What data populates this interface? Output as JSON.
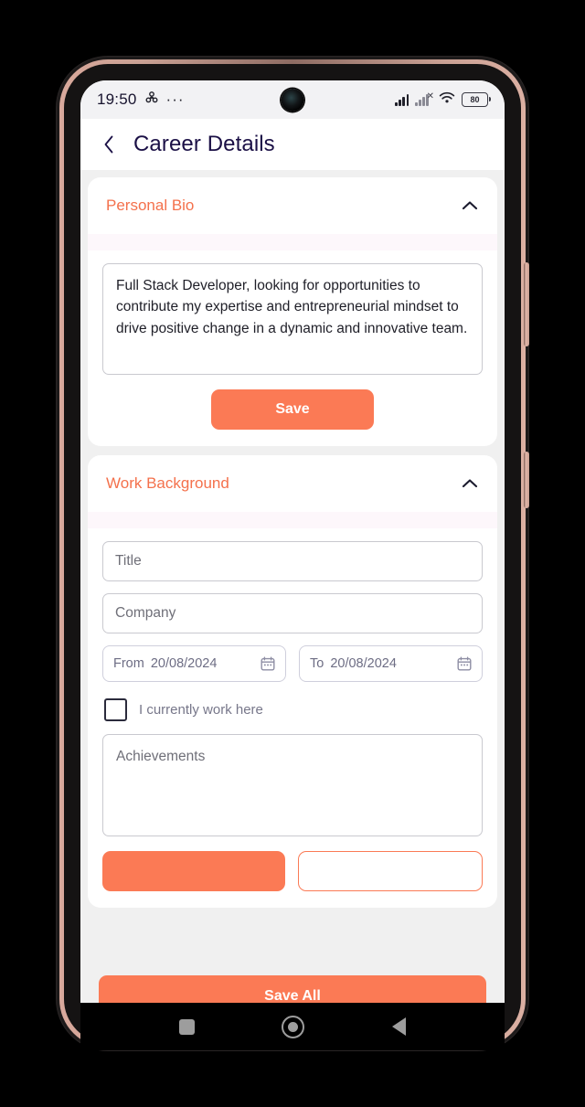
{
  "status_bar": {
    "time": "19:50",
    "icons": [
      "bluetooth-icon",
      "more-icon"
    ],
    "more_glyph": "···",
    "battery_level": "80",
    "right_icons": [
      "signal-bars-icon",
      "signal-no-sim-icon",
      "wifi-icon",
      "battery-icon"
    ]
  },
  "app_bar": {
    "back_label": "‹",
    "title": "Career Details"
  },
  "sections": {
    "personal_bio": {
      "title": "Personal Bio",
      "expanded": true,
      "chevron": "chevron-up-icon",
      "bio_text": "Full Stack Developer, looking for opportunities to contribute my expertise and entrepreneurial mindset to drive positive change in a dynamic and innovative team.",
      "save_label": "Save"
    },
    "work_background": {
      "title": "Work Background",
      "expanded": true,
      "chevron": "chevron-up-icon",
      "fields": {
        "title_placeholder": "Title",
        "company_placeholder": "Company",
        "from_label": "From",
        "from_date": "20/08/2024",
        "to_label": "To",
        "to_date": "20/08/2024",
        "current_work_label": "I currently work here",
        "current_work_checked": false,
        "achievements_placeholder": "Achievements"
      },
      "primary_button_label": "",
      "outline_button_label": ""
    }
  },
  "bottom_bar": {
    "save_all_label": "Save All"
  },
  "nav_bar": {
    "items": [
      "recents-button",
      "home-button",
      "back-button"
    ]
  },
  "colors": {
    "accent": "#fb7a55",
    "title": "#1b1046",
    "page_background": "#f0f0f0",
    "card_background": "#ffffff",
    "band": "#fdf7fb",
    "placeholder": "#6f6f78"
  }
}
